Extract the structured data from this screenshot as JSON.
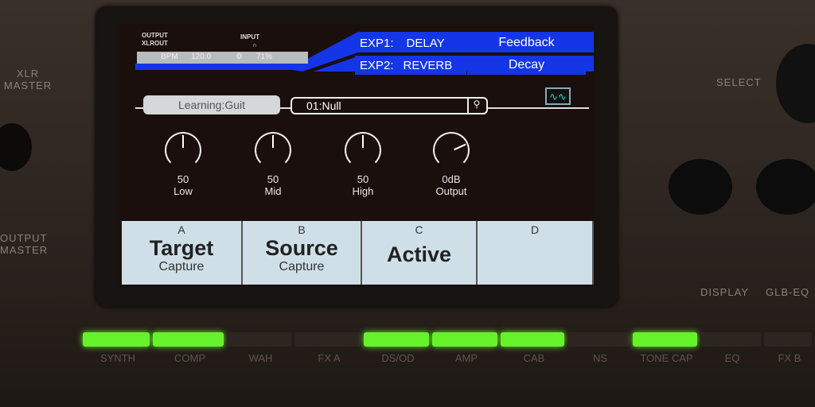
{
  "device": {
    "left_labels": [
      "XLR\nMASTER",
      "OUTPUT\nMASTER"
    ],
    "right_labels": {
      "select": "SELECT",
      "display": "DISPLAY",
      "glb_eq": "GLB-EQ"
    }
  },
  "screen": {
    "status": {
      "output": "OUTPUT",
      "xlrout": "XLROUT",
      "input": "INPUT",
      "headphone_icon": "headphones-icon",
      "bpm_label": "BPM",
      "bpm": "120.0",
      "volume_icon": "gear-icon",
      "volume": "71%"
    },
    "exp": [
      {
        "label": "EXP1:",
        "effect": "DELAY",
        "param": "Feedback"
      },
      {
        "label": "EXP2:",
        "effect": "REVERB",
        "param": "Decay"
      }
    ],
    "accent": "#1436e6",
    "learning": "Learning:Guit",
    "preset": "01:Null",
    "knobs": [
      {
        "value": "50",
        "label": "Low",
        "rotation": 0
      },
      {
        "value": "50",
        "label": "Mid",
        "rotation": 0
      },
      {
        "value": "50",
        "label": "High",
        "rotation": 0
      },
      {
        "value": "0dB",
        "label": "Output",
        "rotation": 65
      }
    ],
    "buttons": [
      {
        "key": "A",
        "title": "Target",
        "sub": "Capture"
      },
      {
        "key": "B",
        "title": "Source",
        "sub": "Capture"
      },
      {
        "key": "C",
        "title": "Active",
        "sub": ""
      },
      {
        "key": "D",
        "title": "",
        "sub": ""
      }
    ]
  },
  "modules": [
    {
      "label": "SYNTH",
      "on": true
    },
    {
      "label": "COMP",
      "on": true
    },
    {
      "label": "WAH",
      "on": false
    },
    {
      "label": "FX A",
      "on": false
    },
    {
      "label": "DS/OD",
      "on": true
    },
    {
      "label": "AMP",
      "on": true
    },
    {
      "label": "CAB",
      "on": true
    },
    {
      "label": "NS",
      "on": false
    },
    {
      "label": "TONE CAP",
      "on": true
    },
    {
      "label": "EQ",
      "on": false
    },
    {
      "label": "FX B",
      "on": false
    }
  ],
  "led_on_color": "#66f22a"
}
